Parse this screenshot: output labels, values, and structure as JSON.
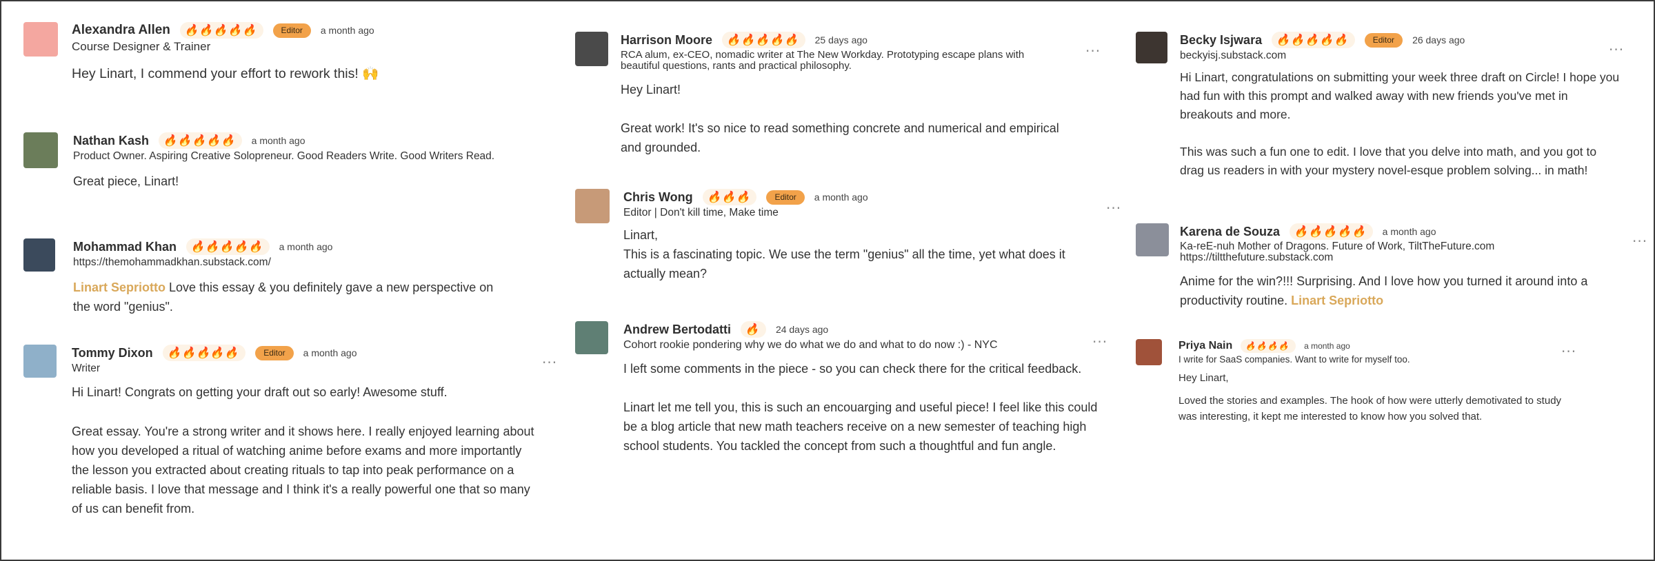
{
  "colors": {
    "accent": "#f19a2e",
    "badge": "#f2a24a",
    "mention": "#d9a85a",
    "border": "#3a3a3a"
  },
  "icons": {
    "rating": "flame-icon",
    "more": "more-horizontal-icon"
  },
  "comments": [
    {
      "name": "Alexandra Allen",
      "rating": 5,
      "badge": "Editor",
      "time": "a month ago",
      "subtitle": "Course Designer & Trainer",
      "paragraphs": [
        "Hey Linart, I commend your effort to rework this! 🙌"
      ],
      "avatar_bg": "#f4a7a0"
    },
    {
      "name": "Nathan Kash",
      "rating": 5,
      "time": "a month ago",
      "subtitle": "Product Owner. Aspiring Creative Solopreneur. Good Readers Write. Good Writers Read.",
      "paragraphs": [
        "Great piece, Linart!"
      ],
      "avatar_bg": "#6b7d5a"
    },
    {
      "name": "Mohammad Khan",
      "rating": 5,
      "time": "a month ago",
      "subtitle": "https://themohammadkhan.substack.com/",
      "mention": "Linart Sepriotto",
      "paragraphs": [
        "Love this essay & you definitely gave a new perspective on the word \"genius\"."
      ],
      "avatar_bg": "#3b4a5c"
    },
    {
      "name": "Tommy Dixon",
      "rating": 5,
      "badge": "Editor",
      "time": "a month ago",
      "subtitle": "Writer",
      "paragraphs": [
        "Hi Linart! Congrats on getting your draft out so early! Awesome stuff.",
        "Great essay. You're a strong writer and it shows here. I really enjoyed learning about how you developed a ritual of watching anime before exams and more importantly the lesson you extracted about creating rituals to tap into peak performance on a reliable basis. I love that message and I think it's a really powerful one that so many of us can benefit from."
      ],
      "avatar_bg": "#8fb0c9"
    },
    {
      "name": "Harrison Moore",
      "rating": 5,
      "time": "25 days ago",
      "subtitle": "RCA alum, ex-CEO, nomadic writer at The New Workday. Prototyping escape plans with beautiful questions, rants and practical philosophy.",
      "paragraphs": [
        "Hey Linart!",
        "Great work! It's so nice to read something concrete and numerical and empirical and grounded."
      ],
      "avatar_bg": "#4a4a4a"
    },
    {
      "name": "Chris Wong",
      "rating": 3,
      "badge": "Editor",
      "time": "a month ago",
      "subtitle": "Editor | Don't kill time, Make time",
      "paragraphs": [
        "Linart,",
        "This is a fascinating topic.  We use the term \"genius\" all the time, yet what does it actually mean?"
      ],
      "avatar_bg": "#c79a78"
    },
    {
      "name": "Andrew Bertodatti",
      "rating": 1,
      "time": "24 days ago",
      "subtitle": "Cohort rookie pondering why we do what we do and what to do now :) - NYC",
      "paragraphs": [
        "I left some comments in the piece - so you can check there for the critical feedback.",
        "Linart let me tell you, this is such an encouarging and useful piece! I feel like this could be a blog article that new math teachers receive on a new semester of teaching high school students. You tackled the concept from such a thoughtful and fun angle."
      ],
      "avatar_bg": "#5f7f74"
    },
    {
      "name": "Becky Isjwara",
      "rating": 5,
      "badge": "Editor",
      "time": "26 days ago",
      "subtitle": "beckyisj.substack.com",
      "paragraphs": [
        "Hi Linart, congratulations on submitting your week three draft on Circle! I hope you had fun with this prompt and walked away with new friends you've met in breakouts and more.",
        "This was such a fun one to edit. I love that you delve into math, and you got to drag us readers in with your mystery novel-esque problem solving... in math!"
      ],
      "avatar_bg": "#3d3530"
    },
    {
      "name": "Karena de Souza",
      "rating": 5,
      "time": "a month ago",
      "subtitle": "Ka-reE-nuh Mother of Dragons. Future of Work, TiltTheFuture.com https://tiltthefuture.substack.com",
      "paragraphs": [
        "Anime for the win?!!! Surprising. And I love how you turned it around into a productivity routine."
      ],
      "mention_after": "Linart Sepriotto",
      "avatar_bg": "#8b8f9a"
    },
    {
      "name": "Priya Nain",
      "rating": 4,
      "time": "a month ago",
      "subtitle": "I write for SaaS companies. Want to write for myself too.",
      "paragraphs": [
        "Hey Linart,",
        "Loved the stories and examples. The hook of how were utterly demotivated to study was interesting, it kept me interested to know how you solved that."
      ],
      "avatar_bg": "#a0523a"
    }
  ]
}
